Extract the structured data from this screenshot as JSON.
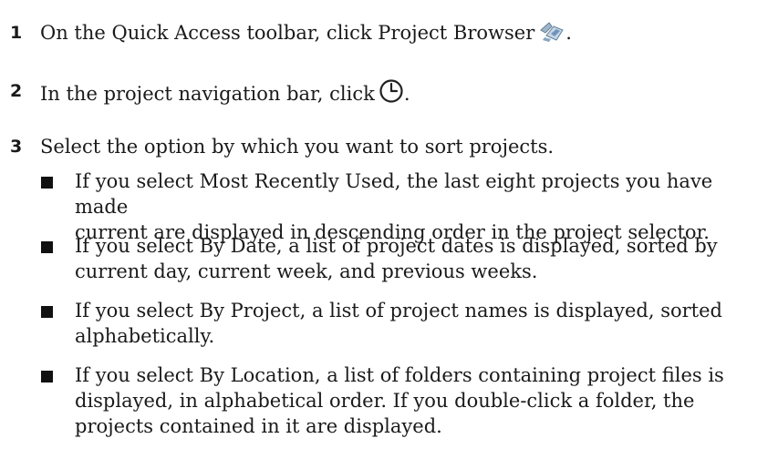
{
  "steps": [
    {
      "number": "1",
      "text": "On the Quick Access toolbar, click Project Browser",
      "suffix": ".",
      "icon": "project-browser-icon"
    },
    {
      "number": "2",
      "text": "In the project navigation bar, click",
      "suffix": ".",
      "icon": "clock-icon"
    },
    {
      "number": "3",
      "text": "Select the option by which you want to sort projects."
    }
  ],
  "bullets": [
    {
      "line1": "If you select Most Recently Used, the last eight projects you have made",
      "line2": "current are displayed in descending order in the project selector."
    },
    {
      "line1": "If you select By Date, a list of project dates is displayed, sorted by",
      "line2": "current day, current week, and previous weeks."
    },
    {
      "line1": "If you select By Project, a list of project names is displayed, sorted",
      "line2": "alphabetically."
    },
    {
      "line1": "If you select By Location, a list of folders containing project files is",
      "line2": "displayed, in alphabetical order. If you double-click a folder, the",
      "line3": "projects contained in it are displayed."
    }
  ]
}
